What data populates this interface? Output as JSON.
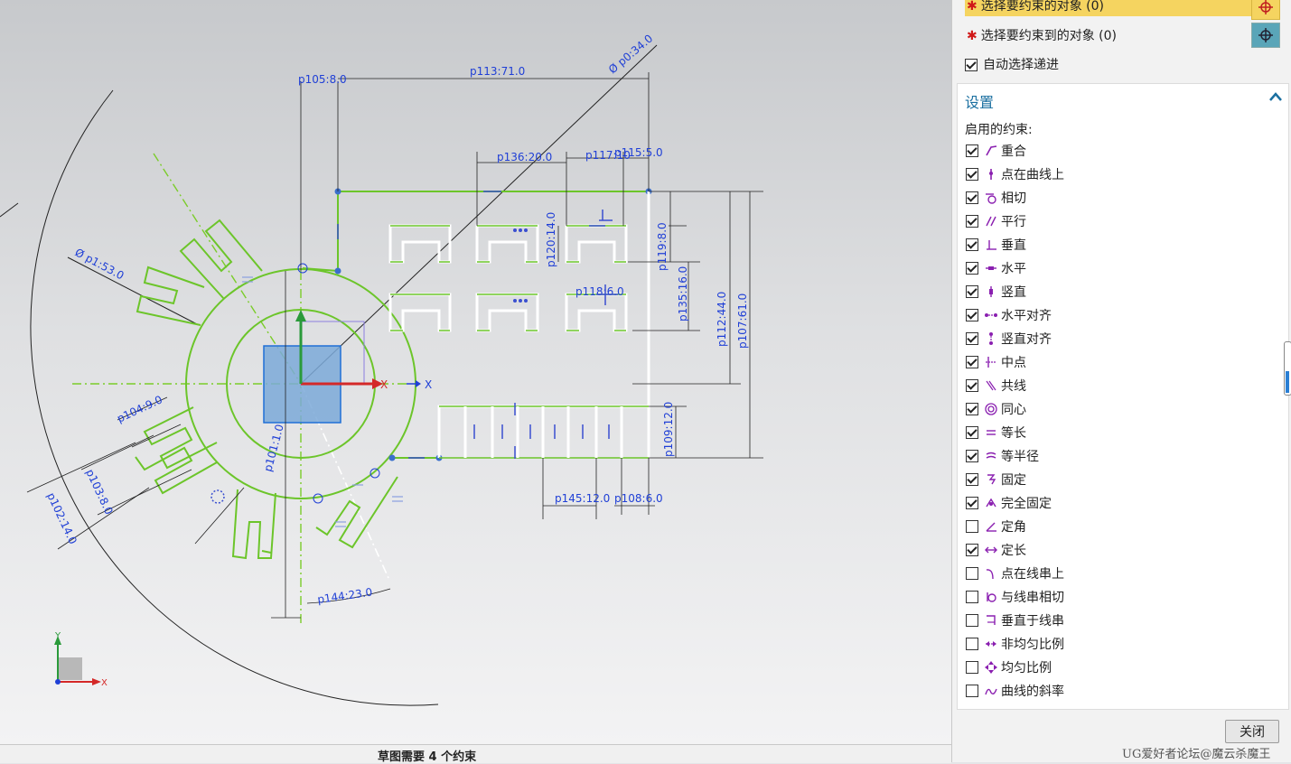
{
  "canvas": {
    "dimensions": [
      {
        "text": "p105:8.0"
      },
      {
        "text": "p113:71.0"
      },
      {
        "text": "Ø p0:34.0"
      },
      {
        "text": "p136:20.0"
      },
      {
        "text": "p117:10"
      },
      {
        "text": "p115:5.0"
      },
      {
        "text": "Ø p1:53.0"
      },
      {
        "text": "p120:14.0"
      },
      {
        "text": "p119:8.0"
      },
      {
        "text": "p118:6.0"
      },
      {
        "text": "p135:16.0"
      },
      {
        "text": "p112:44.0"
      },
      {
        "text": "p107:61.0"
      },
      {
        "text": "p104:9.0"
      },
      {
        "text": "p103:8.0"
      },
      {
        "text": "p102:14.0"
      },
      {
        "text": "p101:1.0"
      },
      {
        "text": "p109:12.0"
      },
      {
        "text": "p145:12.0"
      },
      {
        "text": "p108:6.0"
      },
      {
        "text": "p144:23.0"
      }
    ],
    "axis_labels": {
      "x": "X",
      "y": "Y",
      "small_x": "X",
      "small_y": "Y"
    }
  },
  "status": {
    "message": "草图需要 4 个约束"
  },
  "panel": {
    "select_object": "选择要约束的对象 (0)",
    "select_target": "选择要约束到的对象 (0)",
    "auto_select": "自动选择递进",
    "settings_title": "设置",
    "enabled_label": "启用的约束:",
    "constraints": [
      {
        "label": "重合",
        "checked": true,
        "icon": "coincident-icon"
      },
      {
        "label": "点在曲线上",
        "checked": true,
        "icon": "point-on-curve-icon"
      },
      {
        "label": "相切",
        "checked": true,
        "icon": "tangent-icon"
      },
      {
        "label": "平行",
        "checked": true,
        "icon": "parallel-icon"
      },
      {
        "label": "垂直",
        "checked": true,
        "icon": "perpendicular-icon"
      },
      {
        "label": "水平",
        "checked": true,
        "icon": "horizontal-icon"
      },
      {
        "label": "竖直",
        "checked": true,
        "icon": "vertical-icon"
      },
      {
        "label": "水平对齐",
        "checked": true,
        "icon": "horizontal-align-icon"
      },
      {
        "label": "竖直对齐",
        "checked": true,
        "icon": "vertical-align-icon"
      },
      {
        "label": "中点",
        "checked": true,
        "icon": "midpoint-icon"
      },
      {
        "label": "共线",
        "checked": true,
        "icon": "collinear-icon"
      },
      {
        "label": "同心",
        "checked": true,
        "icon": "concentric-icon"
      },
      {
        "label": "等长",
        "checked": true,
        "icon": "equal-length-icon"
      },
      {
        "label": "等半径",
        "checked": true,
        "icon": "equal-radius-icon"
      },
      {
        "label": "固定",
        "checked": true,
        "icon": "fixed-icon"
      },
      {
        "label": "完全固定",
        "checked": true,
        "icon": "fully-fixed-icon"
      },
      {
        "label": "定角",
        "checked": false,
        "icon": "constant-angle-icon"
      },
      {
        "label": "定长",
        "checked": true,
        "icon": "constant-length-icon"
      },
      {
        "label": "点在线串上",
        "checked": false,
        "icon": "point-on-string-icon"
      },
      {
        "label": "与线串相切",
        "checked": false,
        "icon": "tangent-to-string-icon"
      },
      {
        "label": "垂直于线串",
        "checked": false,
        "icon": "perpendicular-to-string-icon"
      },
      {
        "label": "非均匀比例",
        "checked": false,
        "icon": "non-uniform-scale-icon"
      },
      {
        "label": "均匀比例",
        "checked": false,
        "icon": "uniform-scale-icon"
      },
      {
        "label": "曲线的斜率",
        "checked": false,
        "icon": "curve-slope-icon"
      }
    ],
    "close_label": "关闭"
  },
  "watermark": "UG爱好者论坛@魔云杀魔王",
  "colors": {
    "sketch_green": "#6cc52a",
    "dimension_blue": "#1f3fd6",
    "constraint_purple": "#8a1fb0",
    "accent": "#1a6fa0"
  }
}
